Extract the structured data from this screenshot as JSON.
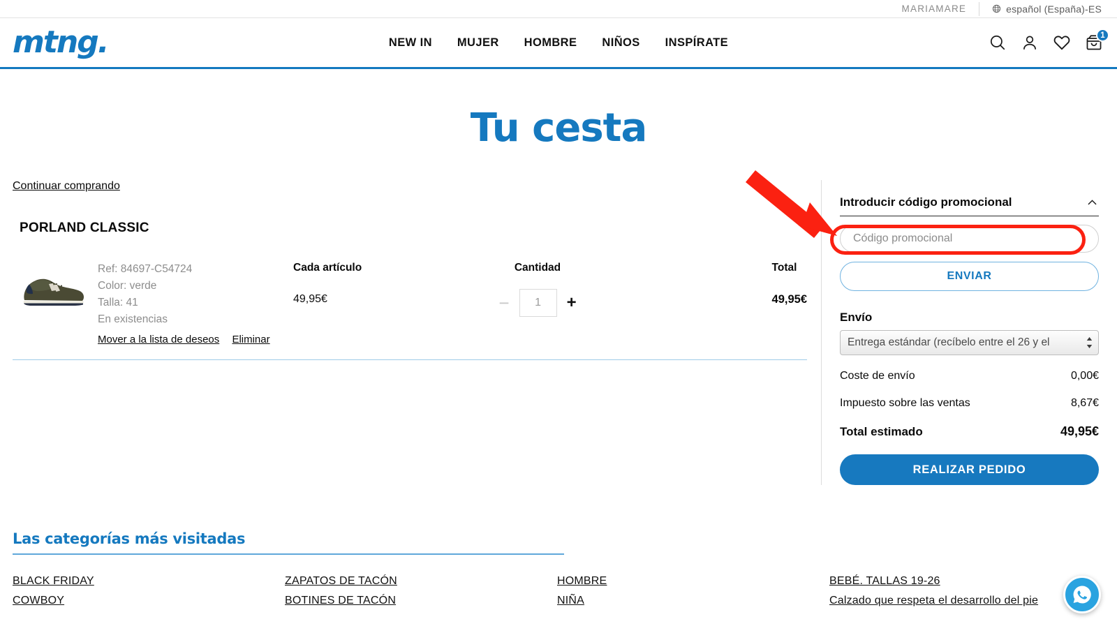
{
  "utility": {
    "account": "MARIAMARE",
    "globe_icon": "globe-icon",
    "language": "español (España)-ES"
  },
  "header": {
    "logo": "mtng.",
    "nav": [
      {
        "label": "NEW IN"
      },
      {
        "label": "MUJER"
      },
      {
        "label": "HOMBRE"
      },
      {
        "label": "NIÑOS"
      },
      {
        "label": "INSPÍRATE"
      }
    ],
    "icons": {
      "search": "search-icon",
      "account": "user-icon",
      "wishlist": "heart-icon",
      "cart": "cart-icon"
    },
    "cart_count": "1",
    "accent_color": "#1579bf"
  },
  "page": {
    "title": "Tu cesta",
    "continue_shopping": "Continuar comprando"
  },
  "cart": {
    "columns": {
      "each_item": "Cada artículo",
      "quantity": "Cantidad",
      "total": "Total"
    },
    "item": {
      "name": "PORLAND CLASSIC",
      "ref": "Ref: 84697-C54724",
      "color": "Color: verde",
      "size": "Talla: 41",
      "availability": "En existencias",
      "move_to_wishlist": "Mover a la lista de deseos",
      "remove": "Eliminar",
      "unit_price": "49,95€",
      "quantity": "1",
      "decrease": "−",
      "increase": "+",
      "line_total": "49,95€"
    }
  },
  "summary": {
    "promo_title": "Introducir código promocional",
    "collapse_icon": "chevron-up-icon",
    "promo_placeholder": "Código promocional",
    "promo_value": "",
    "submit_label": "ENVIAR",
    "shipping_title": "Envío",
    "shipping_option": "Entrega estándar (recíbelo entre el 26 y el",
    "rows": [
      {
        "label": "Coste de envío",
        "value": "0,00€"
      },
      {
        "label": "Impuesto sobre las ventas",
        "value": "8,67€"
      }
    ],
    "total_label": "Total estimado",
    "total_value": "49,95€",
    "checkout_label": "REALIZAR PEDIDO"
  },
  "categories": {
    "title": "Las categorías más visitadas",
    "items": [
      "BLACK FRIDAY",
      "ZAPATOS DE TACÓN",
      "HOMBRE",
      "BEBÉ. TALLAS 19-26",
      "COWBOY",
      "BOTINES DE TACÓN",
      "NIÑA",
      "Calzado que respeta el desarrollo del pie"
    ]
  },
  "floating": {
    "whatsapp": "whatsapp-icon"
  },
  "annotation": {
    "arrow_color": "#fb2111",
    "highlight_color": "#fb2111",
    "target": "promo-code-input"
  }
}
